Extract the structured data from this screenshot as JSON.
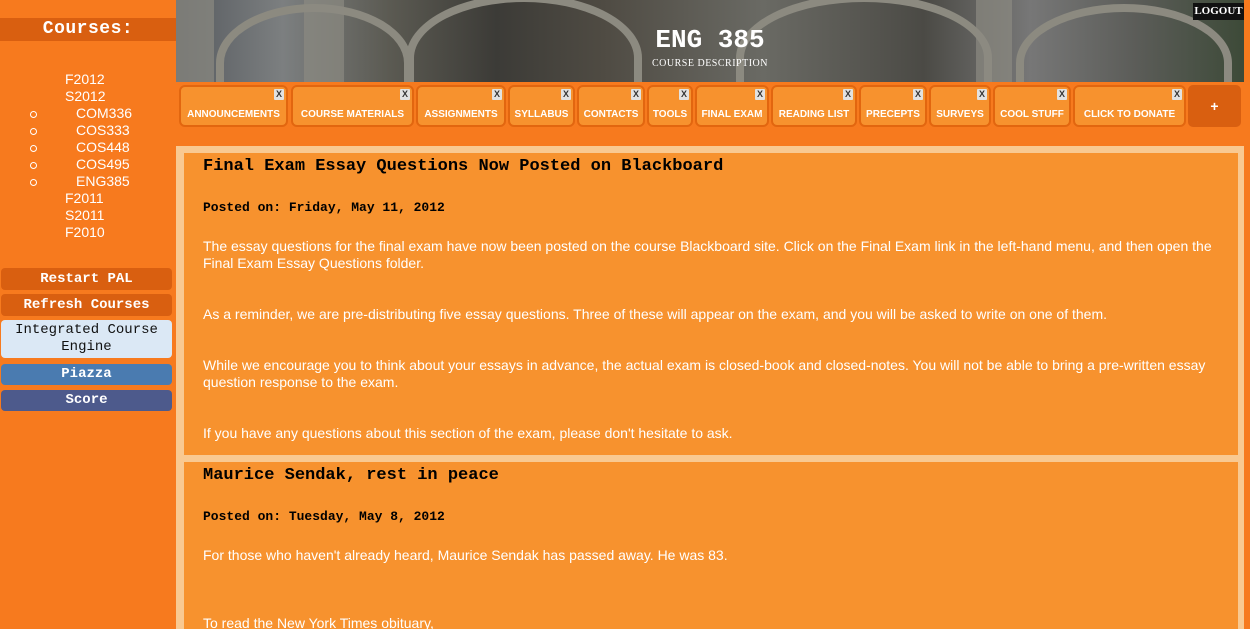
{
  "sidebar": {
    "courses_header": "Courses:",
    "terms": [
      "F2012",
      "S2012"
    ],
    "courses": [
      "COM336",
      "COS333",
      "COS448",
      "COS495",
      "ENG385"
    ],
    "past_terms": [
      "F2011",
      "S2011",
      "F2010"
    ],
    "buttons": {
      "restart": "Restart PAL",
      "refresh": "Refresh Courses",
      "ice": "Integrated Course Engine",
      "piazza": "Piazza",
      "score": "Score"
    }
  },
  "header": {
    "title": "ENG 385",
    "subtitle": "COURSE DESCRIPTION",
    "logout": "LOGOUT"
  },
  "tabs": [
    {
      "label": "ANNOUNCEMENTS"
    },
    {
      "label": "COURSE MATERIALS"
    },
    {
      "label": "ASSIGNMENTS"
    },
    {
      "label": "SYLLABUS"
    },
    {
      "label": "CONTACTS"
    },
    {
      "label": "TOOLS"
    },
    {
      "label": "FINAL EXAM"
    },
    {
      "label": "READING LIST"
    },
    {
      "label": "PRECEPTS"
    },
    {
      "label": "SURVEYS"
    },
    {
      "label": "COOL STUFF"
    },
    {
      "label": "CLICK TO DONATE"
    }
  ],
  "tab_close_glyph": "X",
  "add_tab_label": "+",
  "posts": [
    {
      "title": "Final Exam Essay Questions Now Posted on Blackboard",
      "date": "Posted on: Friday, May 11, 2012",
      "paragraphs": [
        "The essay questions for the final exam have now been posted on the course Blackboard site. Click on the Final Exam link in the left-hand menu, and then open the Final Exam Essay Questions folder.",
        "As a reminder, we are pre-distributing five essay questions. Three of these will appear on the exam, and you will be asked to write on one of them.",
        "While we encourage you to think about your essays in advance, the actual exam is closed-book and closed-notes. You will not be able to bring a pre-written essay question response to the exam.",
        "If you have any questions about this section of the exam, please don't hesitate to ask."
      ]
    },
    {
      "title": "Maurice Sendak, rest in peace",
      "date": "Posted on: Tuesday, May 8, 2012",
      "paragraphs": [
        "For those who haven't already heard, Maurice Sendak has passed away. He was 83.",
        "To read the New York Times obituary,"
      ]
    }
  ],
  "colors": {
    "sidebar_bg": "#f77a1e",
    "header_bar": "#d95f10",
    "tab_bg": "#f7922e",
    "content_border": "#f9c991",
    "piazza": "#4a7bb0",
    "score": "#4d5a8c",
    "ice": "#dbe8f5"
  }
}
